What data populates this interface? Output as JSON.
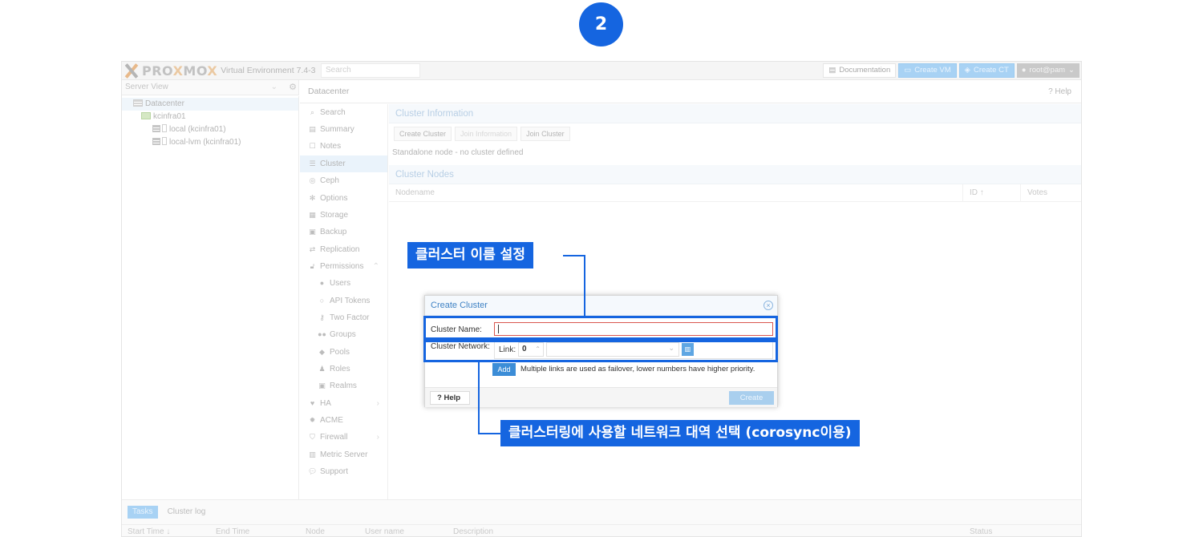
{
  "step": "2",
  "topbar": {
    "logo_text_a": "PRO",
    "logo_x": "X",
    "logo_text_b": "MO",
    "logo_x2": "X",
    "version": "Virtual Environment 7.4-3",
    "search_placeholder": "Search",
    "documentation": "Documentation",
    "create_vm": "Create VM",
    "create_ct": "Create CT",
    "user": "root@pam"
  },
  "server_view": {
    "label": "Server View"
  },
  "tree": [
    {
      "label": "Datacenter",
      "icon": "datacenter-icon"
    },
    {
      "label": "kcinfra01",
      "icon": "node-icon"
    },
    {
      "label": "local (kcinfra01)",
      "icon": "storage-icon"
    },
    {
      "label": "local-lvm (kcinfra01)",
      "icon": "storage-icon"
    }
  ],
  "panel": {
    "title": "Datacenter",
    "help": "Help"
  },
  "menu": [
    {
      "label": "Search",
      "icon": "search-icon"
    },
    {
      "label": "Summary",
      "icon": "book-icon"
    },
    {
      "label": "Notes",
      "icon": "notes-icon"
    },
    {
      "label": "Cluster",
      "icon": "server-icon"
    },
    {
      "label": "Ceph",
      "icon": "ceph-icon"
    },
    {
      "label": "Options",
      "icon": "gear-icon"
    },
    {
      "label": "Storage",
      "icon": "database-icon"
    },
    {
      "label": "Backup",
      "icon": "floppy-icon"
    },
    {
      "label": "Replication",
      "icon": "retweet-icon"
    },
    {
      "label": "Permissions",
      "icon": "unlock-icon"
    },
    {
      "label": "Users",
      "icon": "user-icon"
    },
    {
      "label": "API Tokens",
      "icon": "user-outline-icon"
    },
    {
      "label": "Two Factor",
      "icon": "key-icon"
    },
    {
      "label": "Groups",
      "icon": "users-icon"
    },
    {
      "label": "Pools",
      "icon": "tags-icon"
    },
    {
      "label": "Roles",
      "icon": "male-icon"
    },
    {
      "label": "Realms",
      "icon": "address-book-icon"
    },
    {
      "label": "HA",
      "icon": "heartbeat-icon"
    },
    {
      "label": "ACME",
      "icon": "certificate-icon"
    },
    {
      "label": "Firewall",
      "icon": "shield-icon"
    },
    {
      "label": "Metric Server",
      "icon": "bar-chart-icon"
    },
    {
      "label": "Support",
      "icon": "comments-icon"
    }
  ],
  "cluster": {
    "info_header": "Cluster Information",
    "btn_create": "Create Cluster",
    "btn_join_info": "Join Information",
    "btn_join": "Join Cluster",
    "standalone": "Standalone node - no cluster defined",
    "nodes_header": "Cluster Nodes",
    "col_nodename": "Nodename",
    "col_id": "ID ↑",
    "col_votes": "Votes"
  },
  "bottom": {
    "tab_tasks": "Tasks",
    "tab_log": "Cluster log",
    "cols": [
      "Start Time ↓",
      "End Time",
      "Node",
      "User name",
      "Description",
      "Status"
    ]
  },
  "dialog": {
    "title": "Create Cluster",
    "name_label": "Cluster Name:",
    "name_value": "",
    "network_label": "Cluster Network:",
    "link_label": "Link:",
    "link_value": "0",
    "add": "Add",
    "add_hint": "Multiple links are used as failover, lower numbers have higher priority.",
    "help": "Help",
    "create": "Create"
  },
  "annotations": {
    "name_callout": "클러스터 이름 설정",
    "network_callout": "클러스터링에 사용할 네트워크 대역 선택 (corosync이용)"
  },
  "colors": {
    "accent": "#1565e0",
    "proxmox_blue": "#3c8dd7"
  }
}
